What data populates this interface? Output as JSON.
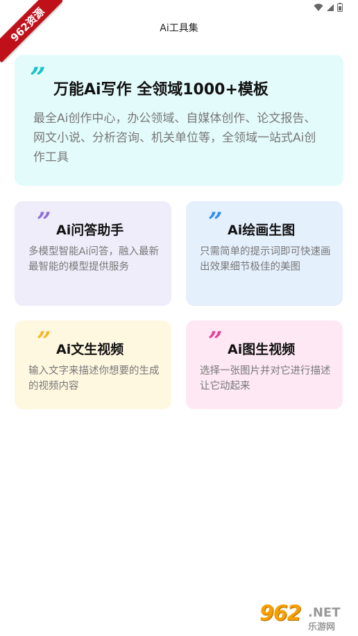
{
  "watermark": {
    "ribbon_text": "962资源",
    "corner_number": "962",
    "corner_domain": ".NET",
    "corner_site_name": "乐游网"
  },
  "header": {
    "title": "Ai工具集"
  },
  "status_bar": {
    "icons": [
      "wifi-icon",
      "signal-icon",
      "battery-icon"
    ]
  },
  "hero": {
    "quote_mark": "”",
    "title": "万能Ai写作 全领域1000+模板",
    "description": "最全Ai创作中心，办公领域、自媒体创作、论文报告、网文小说、分析咨询、机关单位等，全领域一站式Ai创作工具",
    "color": "#e4fbfb",
    "accent": "#17c3c7"
  },
  "cards": [
    {
      "quote_mark": "”",
      "title": "Ai问答助手",
      "description": "多模型智能Ai问答，融入最新最智能的模型提供服务",
      "color": "#f0edfb",
      "accent": "#8e6fd8"
    },
    {
      "quote_mark": "”",
      "title": "Ai绘画生图",
      "description": "只需简单的提示词即可快速画出效果细节极佳的美图",
      "color": "#e5f0fd",
      "accent": "#2f8ff0"
    },
    {
      "quote_mark": "”",
      "title": "Ai文生视频",
      "description": "输入文字来描述你想要的生成的视频内容",
      "color": "#fff8e1",
      "accent": "#f4b82b"
    },
    {
      "quote_mark": "”",
      "title": "Ai图生视频",
      "description": "选择一张图片并对它进行描述让它动起来",
      "color": "#fde8f3",
      "accent": "#e8409a"
    }
  ]
}
